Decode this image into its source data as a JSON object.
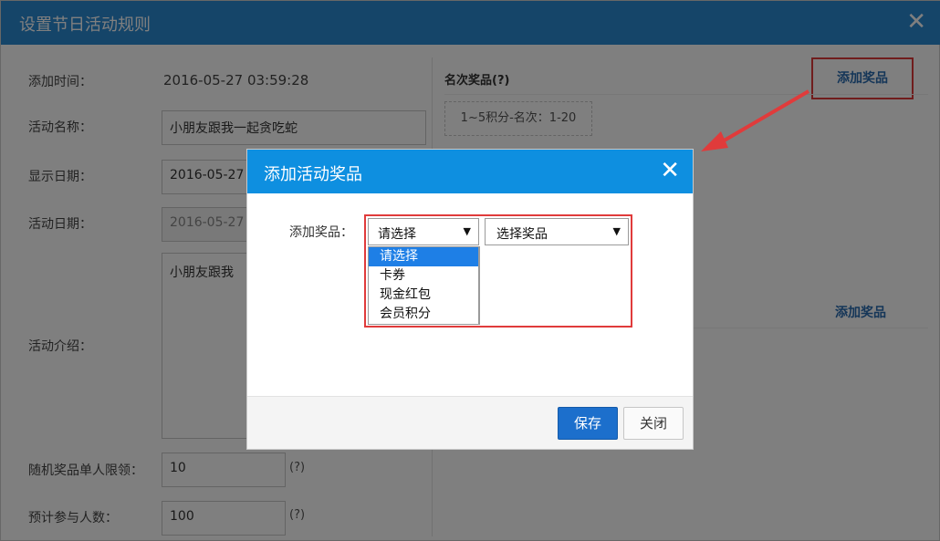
{
  "outer": {
    "title": "设置节日活动规则",
    "close": "✕",
    "form": {
      "add_time_label": "添加时间：",
      "add_time_value": "2016-05-27 03:59:28",
      "name_label": "活动名称：",
      "name_value": "小朋友跟我一起贪吃蛇",
      "display_date_label": "显示日期：",
      "display_date_value": "2016-05-27",
      "activity_date_label": "活动日期：",
      "activity_date_value": "2016-05-27",
      "intro_label": "活动介绍：",
      "intro_value": "小朋友跟我",
      "random_limit_label": "随机奖品单人限领：",
      "random_limit_value": "10",
      "random_limit_hint": "(?)",
      "participants_label": "预计参与人数：",
      "participants_value": "100",
      "participants_hint": "(?)"
    },
    "right": {
      "rank_prize_title": "名次奖品(?)",
      "add_prize_label": "添加奖品",
      "prize_rule": "1~5积分-名次：1-20",
      "add_prize_label_2": "添加奖品"
    }
  },
  "dialog": {
    "title": "添加活动奖品",
    "close": "✕",
    "add_prize_label": "添加奖品：",
    "type_select_value": "请选择",
    "prize_select_value": "选择奖品",
    "type_options": [
      "请选择",
      "卡券",
      "现金红包",
      "会员积分"
    ],
    "save_label": "保存",
    "close_label": "关闭"
  },
  "colors": {
    "header_blue": "#2b8ad3",
    "dialog_header_blue": "#0e8fe0",
    "highlight_red": "#e03b3b",
    "save_button": "#1c6fcc"
  }
}
